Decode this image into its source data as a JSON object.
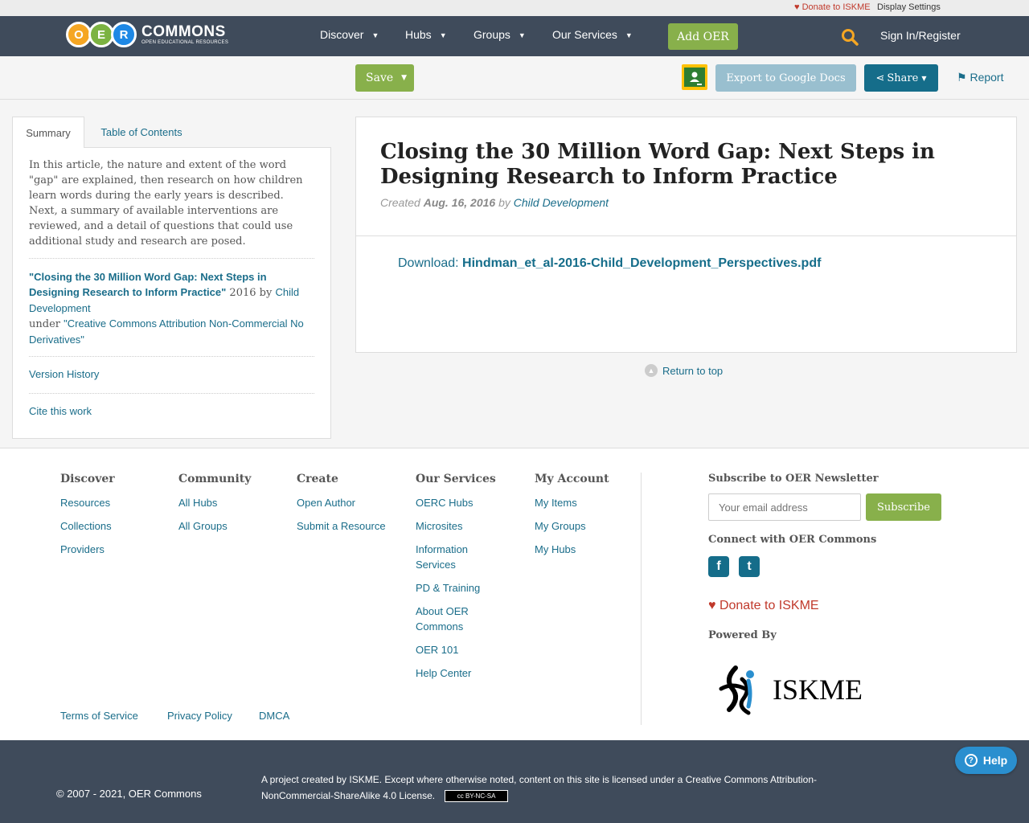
{
  "util": {
    "donate": "Donate to ISKME",
    "display_settings": "Display Settings"
  },
  "nav": {
    "logo_letters": [
      "O",
      "E",
      "R"
    ],
    "logo_title": "COMMONS",
    "logo_subtitle": "OPEN EDUCATIONAL RESOURCES",
    "items": [
      "Discover",
      "Hubs",
      "Groups",
      "Our Services"
    ],
    "add_oer": "Add OER",
    "sign_in": "Sign In/Register"
  },
  "toolbar": {
    "save": "Save",
    "export": "Export to Google Docs",
    "share": "Share",
    "report": "Report"
  },
  "sidebar": {
    "tabs": [
      "Summary",
      "Table of Contents"
    ],
    "summary": "In this article, the nature and extent of the word \"gap\" are explained, then research on how children learn words during the early years is described. Next, a summary of available interventions are reviewed, and a detail of questions that could use additional study and research are posed.",
    "attribution_title": "\"Closing the 30 Million Word Gap: Next Steps in Designing Research to Inform Practice\"",
    "attribution_year_by": " 2016 by ",
    "attribution_author": "Child Development",
    "attribution_under": "under ",
    "attribution_license": "\"Creative Commons Attribution Non-Commercial No Derivatives\"",
    "version_history": "Version History",
    "cite": "Cite this work"
  },
  "main": {
    "title": "Closing the 30 Million Word Gap: Next Steps in Designing Research to Inform Practice",
    "created_label": "Created ",
    "created_date": "Aug. 16, 2016",
    "by": " by ",
    "author": "Child Development",
    "download_label": "Download: ",
    "download_file": "Hindman_et_al-2016-Child_Development_Perspectives.pdf",
    "return_top": "Return to top"
  },
  "footer": {
    "columns": [
      {
        "title": "Discover",
        "links": [
          "Resources",
          "Collections",
          "Providers"
        ]
      },
      {
        "title": "Community",
        "links": [
          "All Hubs",
          "All Groups"
        ]
      },
      {
        "title": "Create",
        "links": [
          "Open Author",
          "Submit a Resource"
        ]
      },
      {
        "title": "Our Services",
        "links": [
          "OERC Hubs",
          "Microsites",
          "Information Services",
          "PD & Training",
          "About OER Commons",
          "OER 101",
          "Help Center"
        ]
      },
      {
        "title": "My Account",
        "links": [
          "My Items",
          "My Groups",
          "My Hubs"
        ]
      }
    ],
    "legal": [
      "Terms of Service",
      "Privacy Policy",
      "DMCA"
    ],
    "newsletter_title": "Subscribe to OER Newsletter",
    "email_placeholder": "Your email address",
    "subscribe": "Subscribe",
    "connect_title": "Connect with OER Commons",
    "facebook_glyph": "f",
    "twitter_glyph": "t",
    "donate": "Donate to ISKME",
    "powered_by": "Powered By",
    "iskme_logo_text": "ISKME"
  },
  "bottom": {
    "copyright": "© 2007 - 2021, OER Commons",
    "project": "A project created by ISKME. Except where otherwise noted, content on this site is licensed under a Creative Commons Attribution-NonCommercial-ShareAlike 4.0 License.",
    "cc_badge": "cc BY-NC-SA",
    "help": "Help"
  },
  "colors": {
    "nav_bg": "#3f4b5b",
    "accent_green": "#88b04b",
    "link_blue": "#1a6d8a",
    "donate_red": "#c0392b"
  }
}
